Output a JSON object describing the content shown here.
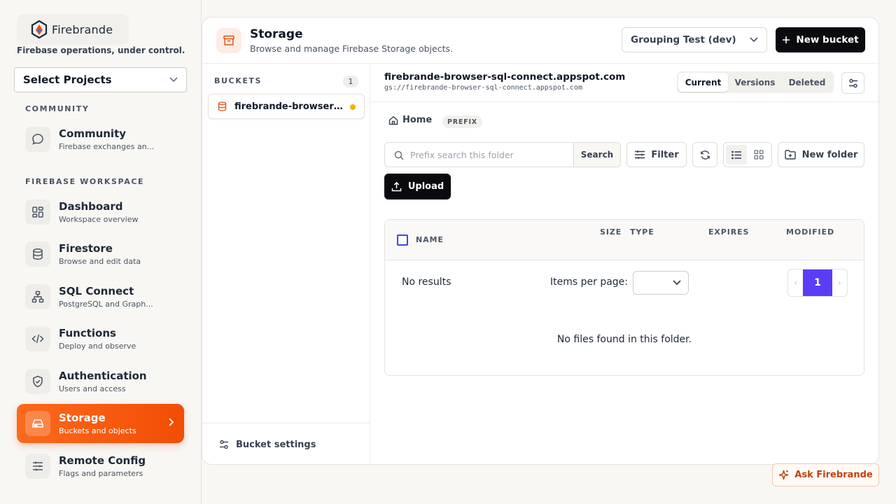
{
  "brand": {
    "name": "Firebrande",
    "tagline": "Firebase operations, under control."
  },
  "sidebar": {
    "project_select": "Select Projects",
    "sections": [
      {
        "label": "COMMUNITY"
      },
      {
        "label": "FIREBASE WORKSPACE"
      }
    ],
    "items": [
      {
        "title": "Community",
        "subtitle": "Firebase exchanges an...",
        "icon": "chat-bubble-icon"
      },
      {
        "title": "Dashboard",
        "subtitle": "Workspace overview",
        "icon": "grid-icon"
      },
      {
        "title": "Firestore",
        "subtitle": "Browse and edit data",
        "icon": "database-icon"
      },
      {
        "title": "SQL Connect",
        "subtitle": "PostgreSQL and Graph...",
        "icon": "network-icon"
      },
      {
        "title": "Functions",
        "subtitle": "Deploy and observe",
        "icon": "code-icon"
      },
      {
        "title": "Authentication",
        "subtitle": "Users and access",
        "icon": "shield-icon"
      },
      {
        "title": "Storage",
        "subtitle": "Buckets and objects",
        "icon": "drive-icon",
        "active": true
      },
      {
        "title": "Remote Config",
        "subtitle": "Flags and parameters",
        "icon": "sliders-icon"
      }
    ]
  },
  "header": {
    "title": "Storage",
    "subtitle": "Browse and manage Firebase Storage objects.",
    "environment": "Grouping Test (dev)",
    "new_bucket_label": "New bucket"
  },
  "buckets": {
    "label": "BUCKETS",
    "count": "1",
    "items": [
      {
        "name": "firebrande-browser-sql-connect.appspot.com"
      }
    ],
    "settings_label": "Bucket settings"
  },
  "content": {
    "bucket_title": "firebrande-browser-sql-connect.appspot.com",
    "bucket_path": "gs://firebrande-browser-sql-connect.appspot.com",
    "tabs": [
      "Current",
      "Versions",
      "Deleted"
    ],
    "active_tab": "Current",
    "breadcrumb_home": "Home",
    "prefix_badge": "PREFIX",
    "search_placeholder": "Prefix search this folder",
    "search_button": "Search",
    "filter_label": "Filter",
    "new_folder_label": "New folder",
    "upload_label": "Upload",
    "table": {
      "columns": [
        "NAME",
        "SIZE",
        "TYPE",
        "EXPIRES",
        "MODIFIED"
      ],
      "no_results": "No results",
      "items_per_page_label": "Items per page:",
      "current_page": "1",
      "empty_message": "No files found in this folder."
    }
  },
  "assistant": {
    "label": "Ask Firebrande"
  },
  "colors": {
    "accent": "#f24d05",
    "pager": "#5b3df5",
    "dark_button": "#0b0b0f"
  }
}
